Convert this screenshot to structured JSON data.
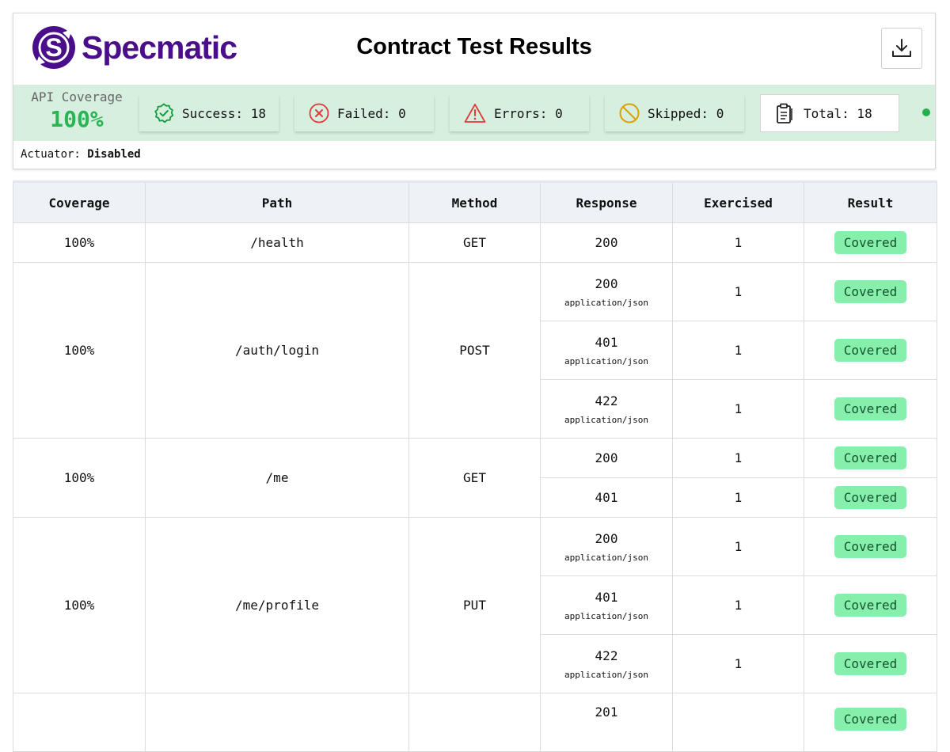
{
  "app": {
    "logo_text": "Specmatic",
    "title": "Contract Test Results",
    "download_icon": "download-icon"
  },
  "summary": {
    "coverage_label": "API Coverage",
    "coverage_value": "100%",
    "success": "Success: 18",
    "failed": "Failed: 0",
    "errors": "Errors: 0",
    "skipped": "Skipped: 0",
    "total": "Total: 18",
    "actuator_label": "Actuator:",
    "actuator_value": "Disabled"
  },
  "colors": {
    "brand": "#4b0e8a",
    "summary_bg": "#d6efdf",
    "coverage_green": "#2bb454",
    "badge_bg": "#86efac"
  },
  "table": {
    "headers": [
      "Coverage",
      "Path",
      "Method",
      "Response",
      "Exercised",
      "Result"
    ],
    "groups": [
      {
        "coverage": "100%",
        "path": "/health",
        "method": "GET",
        "responses": [
          {
            "status": "200",
            "content_type": "",
            "exercised": "1",
            "result": "Covered"
          }
        ]
      },
      {
        "coverage": "100%",
        "path": "/auth/login",
        "method": "POST",
        "responses": [
          {
            "status": "200",
            "content_type": "application/json",
            "exercised": "1",
            "result": "Covered"
          },
          {
            "status": "401",
            "content_type": "application/json",
            "exercised": "1",
            "result": "Covered"
          },
          {
            "status": "422",
            "content_type": "application/json",
            "exercised": "1",
            "result": "Covered"
          }
        ]
      },
      {
        "coverage": "100%",
        "path": "/me",
        "method": "GET",
        "responses": [
          {
            "status": "200",
            "content_type": "",
            "exercised": "1",
            "result": "Covered"
          },
          {
            "status": "401",
            "content_type": "",
            "exercised": "1",
            "result": "Covered"
          }
        ]
      },
      {
        "coverage": "100%",
        "path": "/me/profile",
        "method": "PUT",
        "responses": [
          {
            "status": "200",
            "content_type": "application/json",
            "exercised": "1",
            "result": "Covered"
          },
          {
            "status": "401",
            "content_type": "application/json",
            "exercised": "1",
            "result": "Covered"
          },
          {
            "status": "422",
            "content_type": "application/json",
            "exercised": "1",
            "result": "Covered"
          }
        ]
      },
      {
        "coverage": "",
        "path": "",
        "method": "",
        "responses": [
          {
            "status": "201",
            "content_type": "",
            "exercised": "",
            "result": "Covered"
          }
        ]
      }
    ]
  }
}
